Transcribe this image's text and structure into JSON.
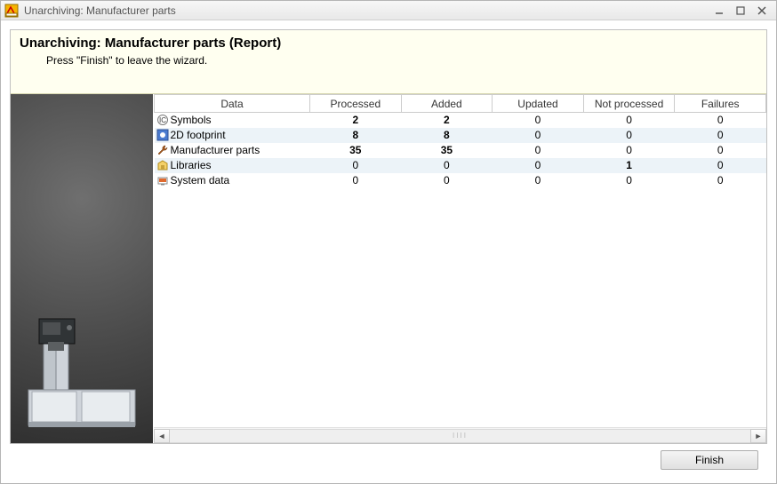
{
  "window": {
    "title": "Unarchiving: Manufacturer parts"
  },
  "banner": {
    "title": "Unarchiving: Manufacturer parts (Report)",
    "subtitle": "Press \"Finish\" to leave the wizard."
  },
  "table": {
    "headers": [
      "Data",
      "Processed",
      "Added",
      "Updated",
      "Not processed",
      "Failures"
    ],
    "rows": [
      {
        "icon": "symbol-icon",
        "label": "Symbols",
        "processed": "2",
        "added": "2",
        "updated": "0",
        "notprocessed": "0",
        "failures": "0",
        "bold_cols": [
          1,
          2
        ]
      },
      {
        "icon": "footprint-icon",
        "label": "2D footprint",
        "processed": "8",
        "added": "8",
        "updated": "0",
        "notprocessed": "0",
        "failures": "0",
        "bold_cols": [
          1,
          2
        ]
      },
      {
        "icon": "wrench-icon",
        "label": "Manufacturer parts",
        "processed": "35",
        "added": "35",
        "updated": "0",
        "notprocessed": "0",
        "failures": "0",
        "bold_cols": [
          1,
          2
        ]
      },
      {
        "icon": "library-icon",
        "label": "Libraries",
        "processed": "0",
        "added": "0",
        "updated": "0",
        "notprocessed": "1",
        "failures": "0",
        "bold_cols": [
          4
        ]
      },
      {
        "icon": "system-icon",
        "label": "System data",
        "processed": "0",
        "added": "0",
        "updated": "0",
        "notprocessed": "0",
        "failures": "0",
        "bold_cols": []
      }
    ]
  },
  "footer": {
    "finish": "Finish"
  }
}
